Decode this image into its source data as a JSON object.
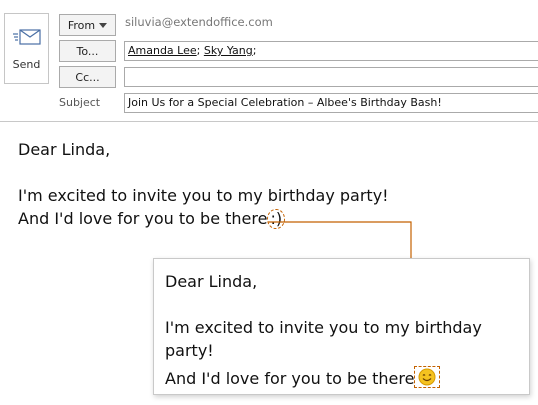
{
  "compose": {
    "send_label": "Send",
    "from_button": "From",
    "from_value": "siluvia@extendoffice.com",
    "to_button": "To...",
    "cc_button": "Cc...",
    "to_recipients": [
      "Amanda Lee",
      "Sky Yang"
    ],
    "cc_value": "",
    "subject_label": "Subject",
    "subject_value": "Join Us for a Special Celebration – Albee's Birthday Bash!"
  },
  "message": {
    "greeting": "Dear Linda,",
    "line1": "I'm excited to invite you to my birthday party!",
    "line2_prefix": "And I'd love for you to be there",
    "emoticon_text": ":)"
  },
  "converted_preview": {
    "greeting": "Dear Linda,",
    "line1": "I'm excited to invite you to my birthday party!",
    "line2_prefix": "And I'd love for you to be there",
    "emoji_icon": "smiley-face-emoji"
  },
  "colors": {
    "annotation": "#c46200",
    "emoji_fill": "#f5c220"
  }
}
